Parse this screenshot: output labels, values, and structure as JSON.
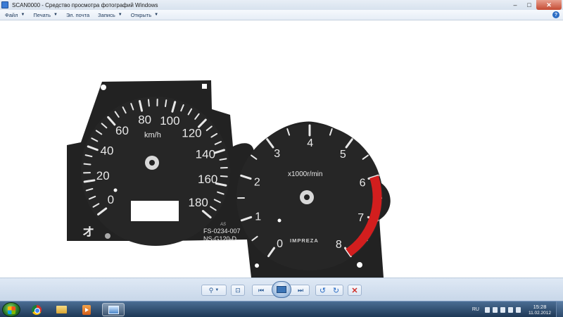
{
  "window": {
    "title": "SCAN0000 - Средство просмотра фотографий Windows",
    "min_glyph": "–",
    "max_glyph": "□",
    "close_glyph": "✕"
  },
  "menu": {
    "items": [
      {
        "label": "Файл"
      },
      {
        "label": "Печать"
      },
      {
        "label": "Эл. почта"
      },
      {
        "label": "Запись"
      },
      {
        "label": "Открыть"
      }
    ],
    "caret": "▼",
    "help_glyph": "?"
  },
  "gauge": {
    "speed_labels": [
      "0",
      "20",
      "40",
      "60",
      "80",
      "100",
      "120",
      "140",
      "160",
      "180"
    ],
    "speed_unit": "km/h",
    "tach_labels": [
      "0",
      "1",
      "2",
      "3",
      "4",
      "5",
      "6",
      "7",
      "8"
    ],
    "tach_unit": "x1000r/min",
    "part_line1": "FS-0234-007",
    "part_line2": "NS-G120-D",
    "brand": "IMPREZA",
    "logo_mark": "AS",
    "symbol": "オ",
    "colors": {
      "face": "#222222",
      "marking": "#e8e8e8",
      "redline": "#d21e1e"
    }
  },
  "controls": {
    "zoom_glyph": "⚲",
    "fit_glyph": "⊡",
    "prev_glyph": "⏮",
    "next_glyph": "⏭",
    "rotate_left_glyph": "↺",
    "rotate_right_glyph": "↻",
    "delete_glyph": "✕"
  },
  "taskbar": {
    "language": "RU",
    "time": "15:28",
    "date": "11.02.2012"
  }
}
